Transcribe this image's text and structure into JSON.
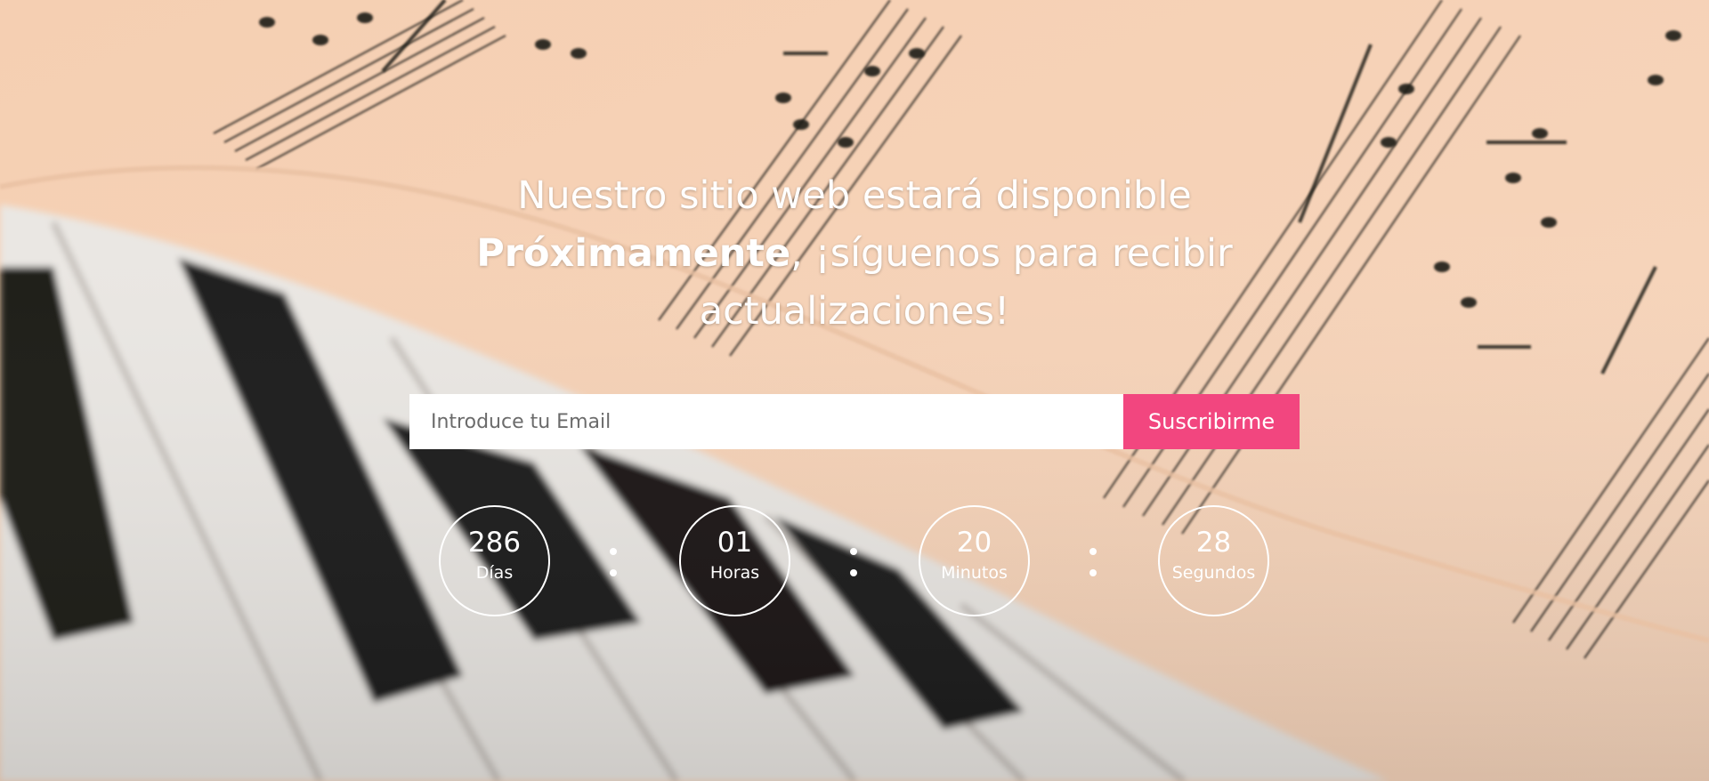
{
  "headline": {
    "line1": "Nuestro sitio web estará disponible",
    "bold": "Próximamente",
    "line2_rest": ", ¡síguenos para recibir",
    "line3": "actualizaciones!"
  },
  "subscribe": {
    "placeholder": "Introduce tu Email",
    "button_label": "Suscribirme"
  },
  "countdown": {
    "days": {
      "value": "286",
      "label": "Días"
    },
    "hours": {
      "value": "01",
      "label": "Horas"
    },
    "minutes": {
      "value": "20",
      "label": "Minutos"
    },
    "seconds": {
      "value": "28",
      "label": "Segundos"
    }
  },
  "colors": {
    "accent": "#f2467f",
    "paper": "#f6d2b6",
    "text": "#ffffff"
  }
}
